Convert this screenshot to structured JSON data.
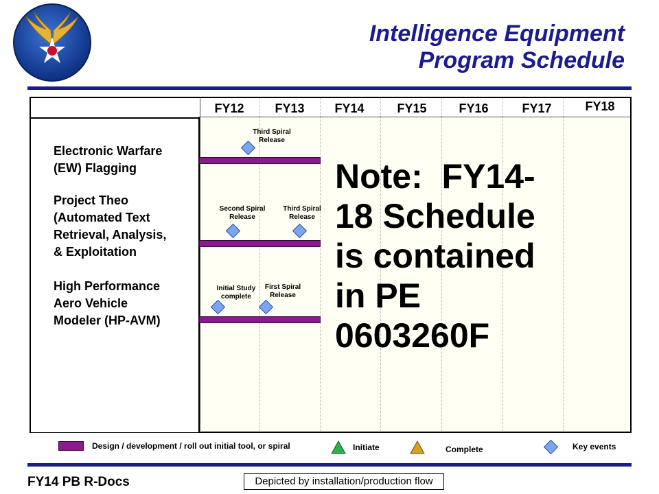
{
  "header": {
    "title_line1": "Intelligence  Equipment",
    "title_line2": "Program Schedule",
    "logo_icon": "air-force-wings-star-roundel-icon"
  },
  "timeline": {
    "fiscal_years": [
      "FY12",
      "FY13",
      "FY14",
      "FY15",
      "FY16",
      "FY17",
      "FY18"
    ]
  },
  "programs": [
    {
      "lines": [
        "Electronic Warfare",
        "(EW)  Flagging"
      ],
      "events": [
        {
          "label_line1": "Third Spiral",
          "label_line2": "Release"
        }
      ]
    },
    {
      "lines": [
        "Project Theo",
        "(Automated Text",
        "Retrieval, Analysis,",
        "& Exploitation"
      ],
      "events": [
        {
          "label_line1": "Second Spiral",
          "label_line2": "Release"
        },
        {
          "label_line1": "Third Spiral",
          "label_line2": "Release"
        }
      ]
    },
    {
      "lines": [
        "High Performance",
        "Aero Vehicle",
        "Modeler (HP-AVM)"
      ],
      "events": [
        {
          "label_line1": "Initial Study",
          "label_line2": "complete"
        },
        {
          "label_line1": "First Spiral",
          "label_line2": "Release"
        }
      ]
    }
  ],
  "note": "Note:  FY14-\n18 Schedule\nis contained\nin PE\n0603260F",
  "legend": {
    "bar_label": "Design / development  / roll out initial tool, or spiral",
    "initiate_label": "Initiate",
    "complete_label": "Complete",
    "key_events_label": "Key events"
  },
  "colors": {
    "title_blue": "#1b1b8f",
    "bar_purple": "#8b1a8f",
    "diamond_blue": "#7aa6f0",
    "initiate_green": "#2db24a",
    "complete_gold": "#d9a01e"
  },
  "footer": {
    "left_text": "FY14 PB R-Docs",
    "box_text": "Depicted by installation/production flow"
  }
}
